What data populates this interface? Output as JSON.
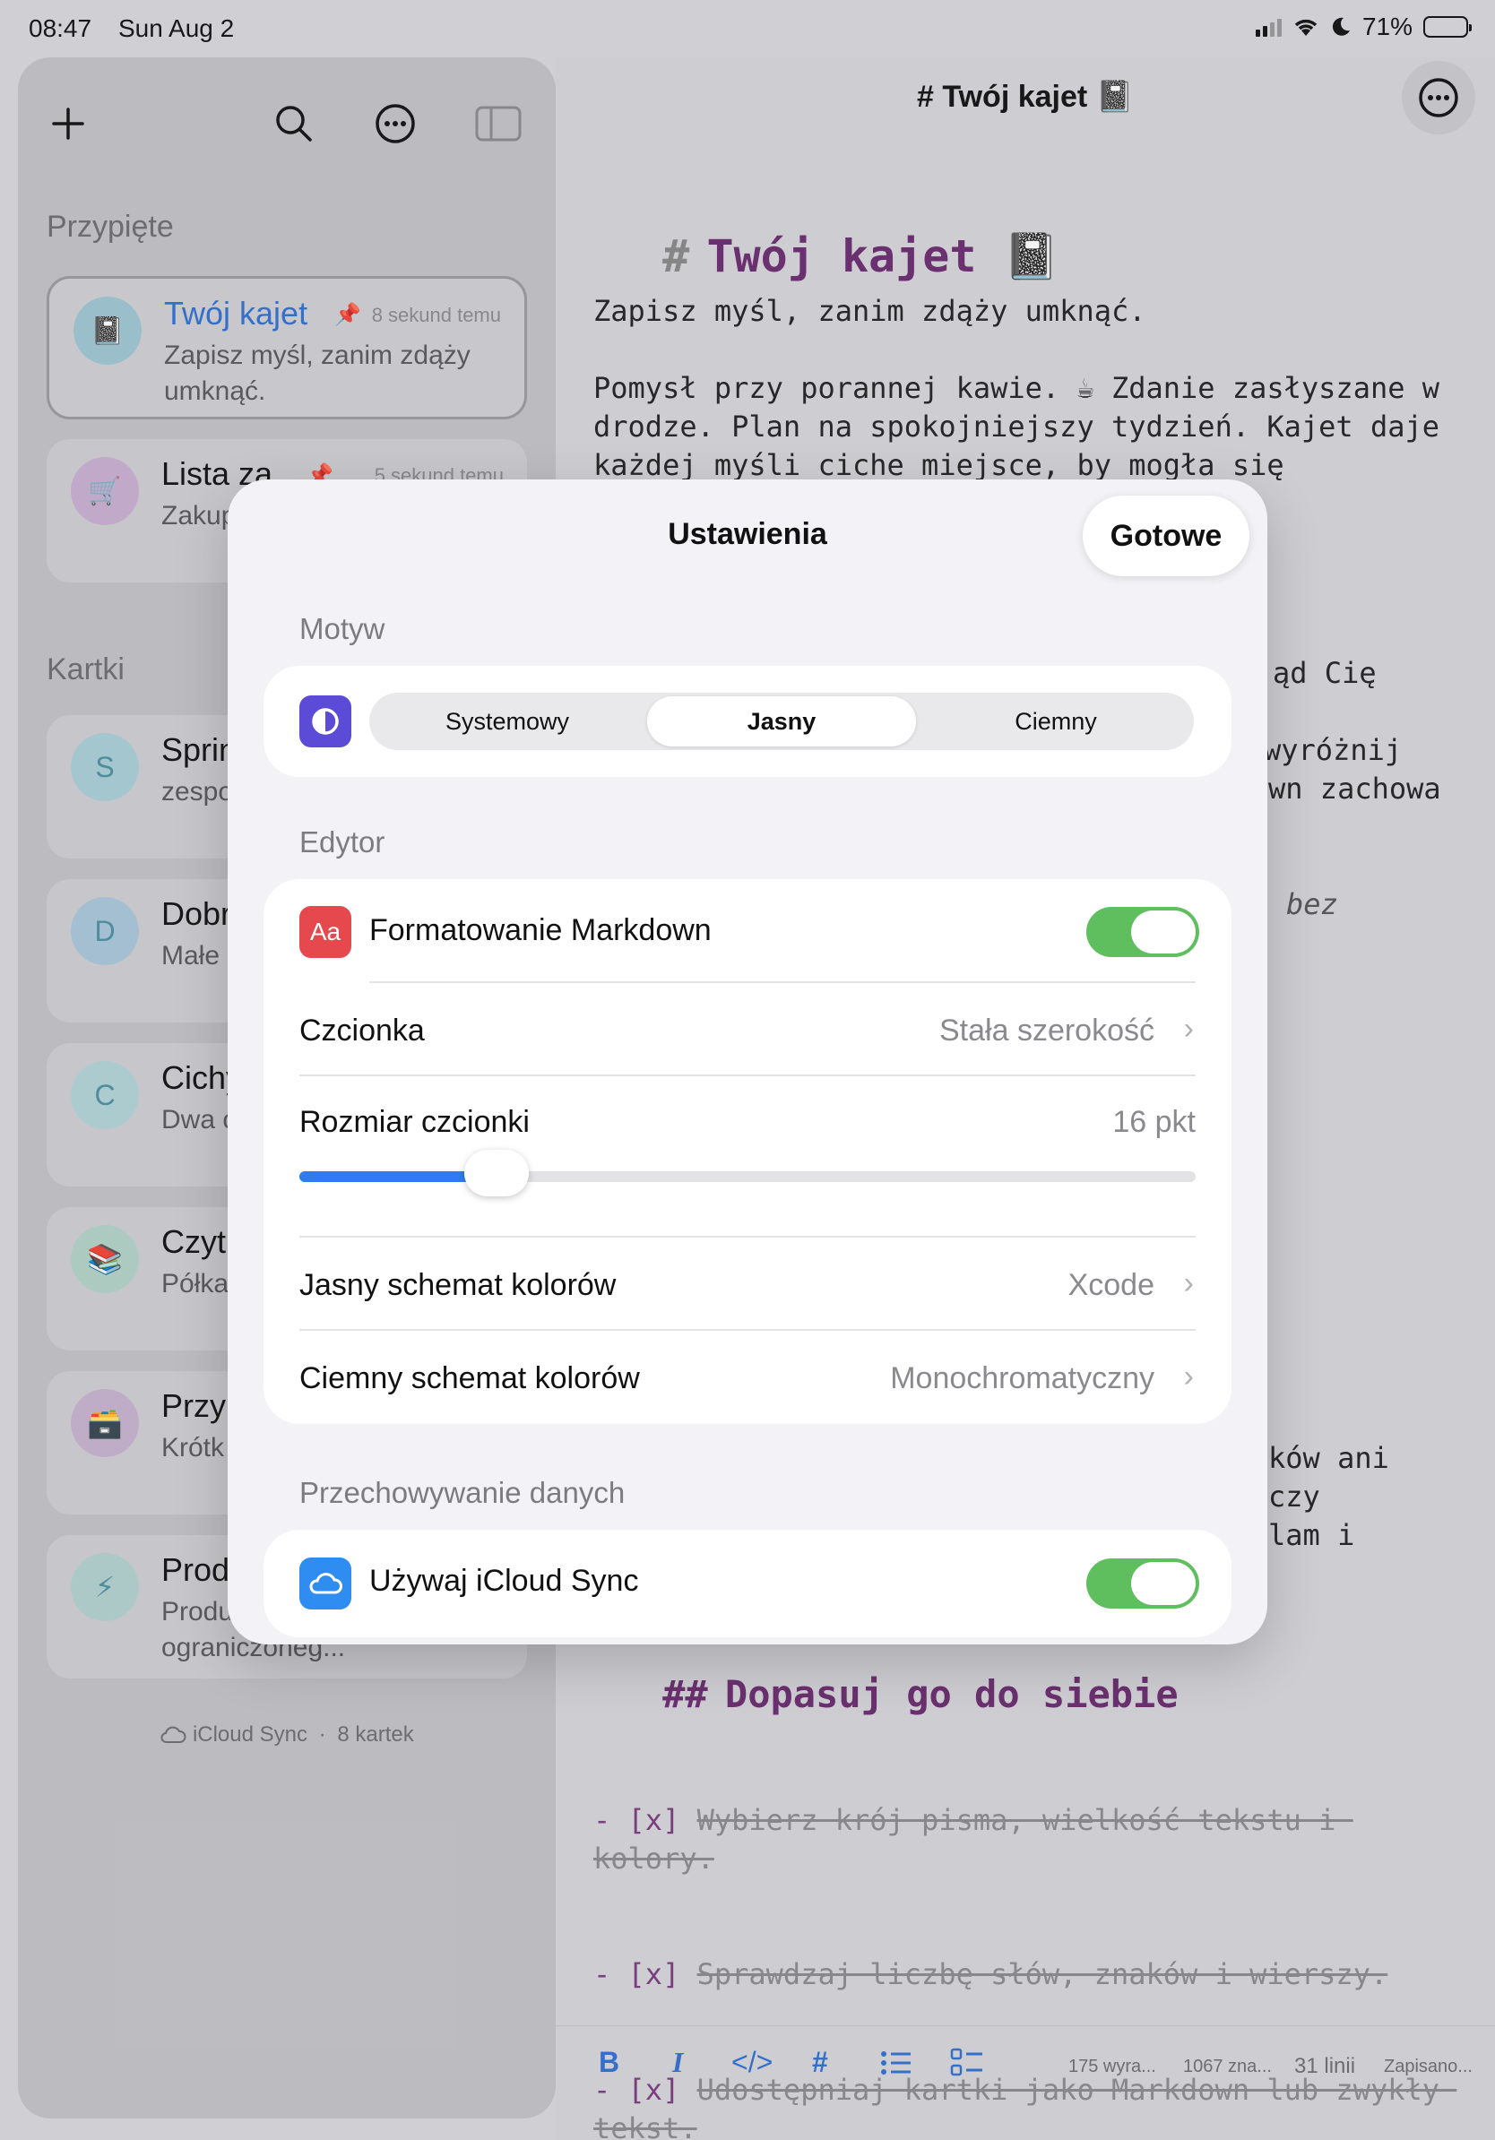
{
  "status_bar": {
    "time": "08:47",
    "date": "Sun Aug 2",
    "battery": "71%",
    "battery_level": 0.71
  },
  "sidebar": {
    "pinned_title": "Przypięte",
    "cards_title": "Kartki",
    "pinned": [
      {
        "emoji": "📓",
        "title": "Twój kajet",
        "time": "8 sekund temu",
        "subtitle": "Zapisz myśl, zanim zdąży umknąć."
      },
      {
        "emoji": "🛒",
        "title": "Lista za",
        "time": "5 sekund temu",
        "subtitle": "Zakup tydzie"
      }
    ],
    "cards": [
      {
        "initial": "S",
        "title": "Sprin",
        "subtitle": "zespo i tech"
      },
      {
        "initial": "D",
        "title": "Dobr",
        "subtitle": "Małe i jedn"
      },
      {
        "initial": "C",
        "title": "Cichy",
        "subtitle": "Dwa c zapla"
      },
      {
        "emoji": "📚",
        "title": "Czyt",
        "subtitle": "Półka dokor"
      },
      {
        "emoji": "🗃️",
        "title": "Przy",
        "subtitle": "Krótk Postg"
      },
      {
        "emoji": "⚡",
        "title": "Prod",
        "subtitle": "Produ zamieniania ograniczoneg..."
      }
    ],
    "footer_sync": "iCloud Sync",
    "footer_sep": "·",
    "footer_count": "8 kartek"
  },
  "editor": {
    "header_title": "# Twój kajet 📓",
    "h1_hash": "#",
    "h1_text": "Twój kajet 📓",
    "line1": "Zapisz myśl, zanim zdąży umknąć.",
    "para2": "Pomysł przy porannej kawie. ☕ Zdanie zasłyszane w drodze. Plan na spokojniejszy tydzień. Kajet daje każdej myśli ciche miejsce, by mogła się",
    "frag1": "ąd Cię",
    "frag2": "wyróżnij",
    "frag3": "wn zachowa",
    "frag4": "bez",
    "frag5": "ków ani",
    "frag6": "czy",
    "frag7": "lam i",
    "h2_hash": "##",
    "h2_text": "Dopasuj go do siebie",
    "tasks": [
      {
        "prefix": "- [x]",
        "text": "Wybierz krój pisma, wielkość tekstu i kolory."
      },
      {
        "prefix": "- [x]",
        "text": "Sprawdzaj liczbę słów, znaków i wierszy."
      },
      {
        "prefix": "- [x]",
        "text": "Udostępniaj kartki jako Markdown lub zwykły tekst."
      }
    ],
    "toolbar": {
      "bold": "B",
      "italic": "I",
      "code": "</>",
      "heading": "#",
      "words": "175 wyra...",
      "chars": "1067 zna...",
      "lines": "31 linii",
      "saved": "Zapisano..."
    }
  },
  "settings": {
    "title": "Ustawienia",
    "done": "Gotowe",
    "theme_section": "Motyw",
    "theme_options": [
      "Systemowy",
      "Jasny",
      "Ciemny"
    ],
    "theme_selected": "Jasny",
    "editor_section": "Edytor",
    "markdown_icon": "Aa",
    "markdown_label": "Formatowanie Markdown",
    "markdown_enabled": true,
    "font_label": "Czcionka",
    "font_value": "Stała szerokość",
    "font_size_label": "Rozmiar czcionki",
    "font_size_value": "16 pkt",
    "font_size_fraction": 0.22,
    "light_scheme_label": "Jasny schemat kolorów",
    "light_scheme_value": "Xcode",
    "dark_scheme_label": "Ciemny schemat kolorów",
    "dark_scheme_value": "Monochromatyczny",
    "storage_section": "Przechowywanie danych",
    "icloud_label": "Używaj iCloud Sync",
    "icloud_enabled": true
  },
  "colors": {
    "accent": "#2f7cf0",
    "toggle_on": "#5fbf5f",
    "theme_icon": "#5b4bd6",
    "markdown_icon": "#e5484d",
    "heading": "#6b2b6e"
  }
}
